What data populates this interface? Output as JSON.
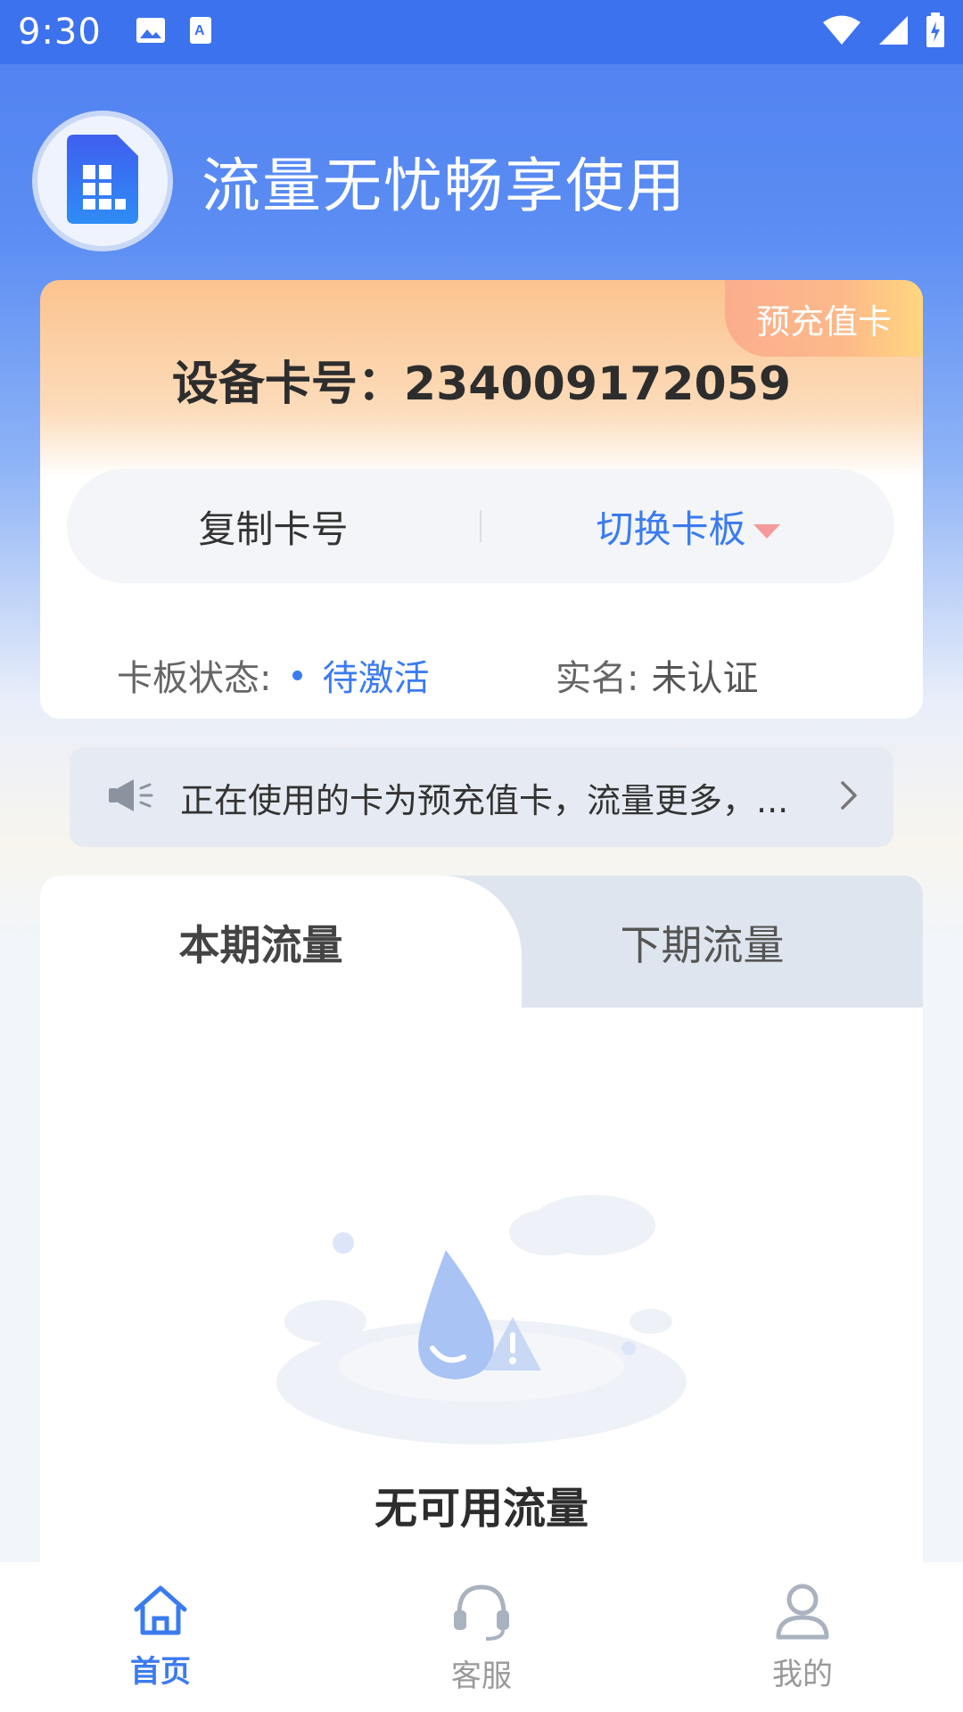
{
  "status_bar": {
    "time": "9:30",
    "icons_left": [
      "image-icon",
      "text-icon"
    ],
    "icons_right": [
      "wifi-icon",
      "signal-icon",
      "battery-icon"
    ]
  },
  "header": {
    "title": "流量无忧畅享使用",
    "logo_icon": "sim-card-icon"
  },
  "card": {
    "badge": "预充值卡",
    "number_label": "设备卡号：",
    "number_value": "234009172059",
    "copy_button": "复制卡号",
    "switch_button": "切换卡板",
    "status_label": "卡板状态:",
    "status_value": "待激活",
    "realname_label": "实名:",
    "realname_value": "未认证"
  },
  "notice": {
    "icon": "speaker-icon",
    "text": "正在使用的卡为预充值卡，流量更多，...",
    "arrow_icon": "chevron-right-icon"
  },
  "usage": {
    "tabs": [
      {
        "label": "本期流量",
        "active": true
      },
      {
        "label": "下期流量",
        "active": false
      }
    ],
    "empty_text": "无可用流量"
  },
  "bottom_nav": [
    {
      "label": "首页",
      "icon": "home-icon",
      "active": true
    },
    {
      "label": "客服",
      "icon": "headset-icon",
      "active": false
    },
    {
      "label": "我的",
      "icon": "user-icon",
      "active": false
    }
  ],
  "colors": {
    "primary": "#3b7bf0",
    "status_bar": "#3d72ee",
    "badge": "#fdb98a"
  }
}
